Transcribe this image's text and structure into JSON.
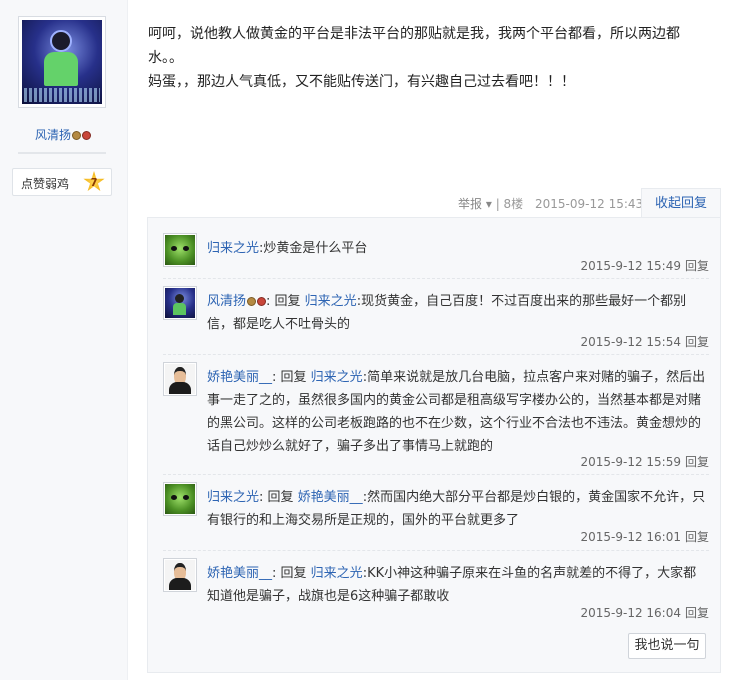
{
  "author": {
    "name": "风清扬",
    "like_label": "点赞弱鸡",
    "like_count": "7"
  },
  "post": {
    "lines": [
      "呵呵，说他教人做黄金的平台是非法平台的那贴就是我，我两个平台都看，所以两边都",
      "水。。",
      "妈蛋，，那边人气真低，又不能贴传送门，有兴趣自己过去看吧！！！"
    ],
    "meta": {
      "report": "举报",
      "floor": "8楼",
      "time": "2015-09-12 15:43",
      "collapse": "收起回复"
    }
  },
  "replies": [
    {
      "user": "归来之光",
      "colon": ":",
      "prefix": "",
      "target": "",
      "text": "炒黄金是什么平台",
      "time": "2015-9-12 15:49",
      "reply_label": "回复",
      "avatar": "alien-avatar"
    },
    {
      "user": "风清扬",
      "colon": ": ",
      "prefix": "回复 ",
      "target": "归来之光",
      "text": ":现货黄金，自己百度！不过百度出来的那些最好一个都别信，都是吃人不吐骨头的",
      "time": "2015-9-12 15:54",
      "reply_label": "回复",
      "avatar": "blue-avatar"
    },
    {
      "user": "娇艳美丽__",
      "colon": ": ",
      "prefix": "回复 ",
      "target": "归来之光",
      "text": ":简单来说就是放几台电脑，拉点客户来对赌的骗子，然后出事一走了之的，虽然很多国内的黄金公司都是租高级写字楼办公的，当然基本都是对赌的黑公司。这样的公司老板跑路的也不在少数，这个行业不合法也不违法。黄金想炒的话自己炒炒么就好了，骗子多出了事情马上就跑的",
      "time": "2015-9-12 15:59",
      "reply_label": "回复",
      "avatar": "man-avatar"
    },
    {
      "user": "归来之光",
      "colon": ": ",
      "prefix": "回复 ",
      "target": "娇艳美丽__",
      "text": ":然而国内绝大部分平台都是炒白银的，黄金国家不允许，只有银行的和上海交易所是正规的，国外的平台就更多了",
      "time": "2015-9-12 16:01",
      "reply_label": "回复",
      "avatar": "alien-avatar"
    },
    {
      "user": "娇艳美丽__",
      "colon": ": ",
      "prefix": "回复 ",
      "target": "归来之光",
      "text": ":KK小神这种骗子原来在斗鱼的名声就差的不得了，大家都知道他是骗子，战旗也是6这种骗子都敢收",
      "time": "2015-9-12 16:04",
      "reply_label": "回复",
      "avatar": "man-avatar"
    }
  ],
  "say_button": "我也说一句"
}
